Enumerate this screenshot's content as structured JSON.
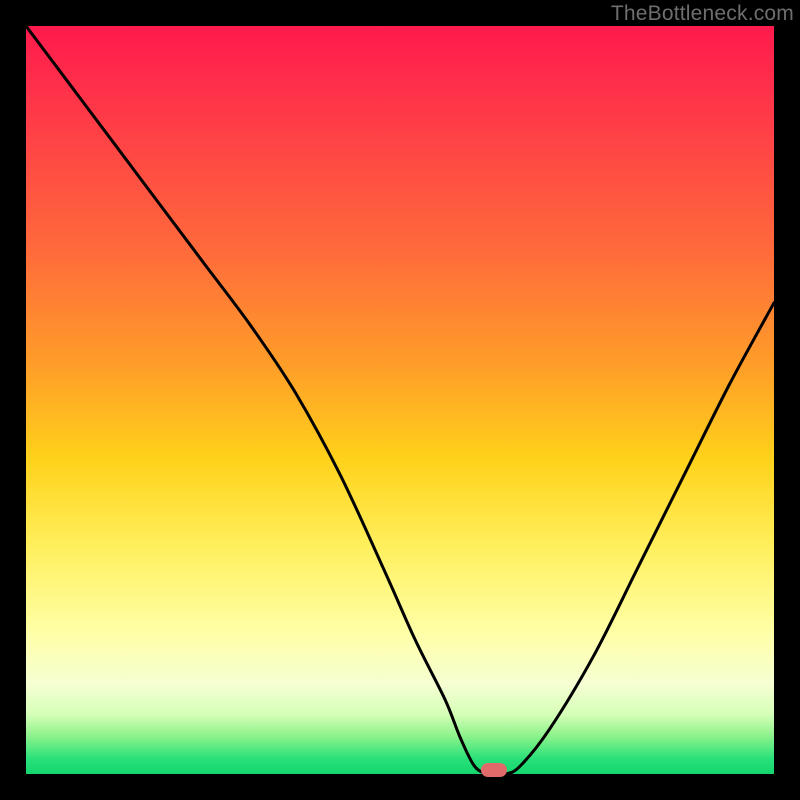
{
  "watermark": {
    "text": "TheBottleneck.com"
  },
  "chart_data": {
    "type": "line",
    "title": "",
    "xlabel": "",
    "ylabel": "",
    "xlim": [
      0,
      100
    ],
    "ylim": [
      0,
      100
    ],
    "grid": false,
    "legend": false,
    "background_gradient": {
      "orientation": "vertical",
      "stops": [
        {
          "pos": 0,
          "color": "#ff1a4d"
        },
        {
          "pos": 30,
          "color": "#ff6a3b"
        },
        {
          "pos": 58,
          "color": "#ffd21a"
        },
        {
          "pos": 81,
          "color": "#ffffa6"
        },
        {
          "pos": 92,
          "color": "#d6ffb8"
        },
        {
          "pos": 100,
          "color": "#14d66c"
        }
      ]
    },
    "series": [
      {
        "name": "bottleneck-curve",
        "color": "#000000",
        "x": [
          0,
          6,
          12,
          18,
          24,
          30,
          36,
          42,
          48,
          52,
          56,
          58,
          60,
          62,
          64,
          66,
          70,
          76,
          82,
          88,
          94,
          100
        ],
        "y": [
          100,
          92,
          84,
          76,
          68,
          60,
          51,
          40,
          27,
          18,
          10,
          5,
          1,
          0,
          0,
          1,
          6,
          16,
          28,
          40,
          52,
          63
        ]
      }
    ],
    "marker": {
      "label": "optimal-point",
      "x": 62.5,
      "y": 0.5,
      "color": "#e06a6a",
      "shape": "pill"
    }
  }
}
